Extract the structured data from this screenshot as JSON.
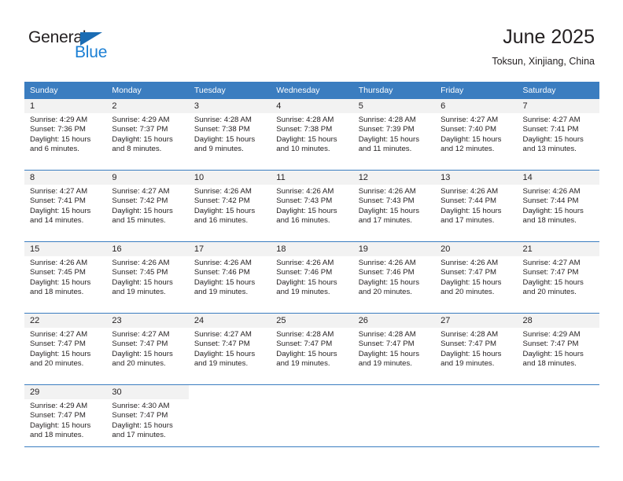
{
  "brand": {
    "name_part1": "General",
    "name_part2": "Blue",
    "accent_color": "#1b7fd4",
    "triangle_color": "#1b6cb3"
  },
  "header": {
    "title": "June 2025",
    "subtitle": "Toksun, Xinjiang, China"
  },
  "theme": {
    "header_band_color": "#3b7dc0",
    "daynum_band_color": "#f2f2f2",
    "text_color": "#231f20"
  },
  "calendar": {
    "weekday_headers": [
      "Sunday",
      "Monday",
      "Tuesday",
      "Wednesday",
      "Thursday",
      "Friday",
      "Saturday"
    ],
    "weeks": [
      [
        {
          "day": "1",
          "sunrise": "Sunrise: 4:29 AM",
          "sunset": "Sunset: 7:36 PM",
          "daylight": "Daylight: 15 hours and 6 minutes."
        },
        {
          "day": "2",
          "sunrise": "Sunrise: 4:29 AM",
          "sunset": "Sunset: 7:37 PM",
          "daylight": "Daylight: 15 hours and 8 minutes."
        },
        {
          "day": "3",
          "sunrise": "Sunrise: 4:28 AM",
          "sunset": "Sunset: 7:38 PM",
          "daylight": "Daylight: 15 hours and 9 minutes."
        },
        {
          "day": "4",
          "sunrise": "Sunrise: 4:28 AM",
          "sunset": "Sunset: 7:38 PM",
          "daylight": "Daylight: 15 hours and 10 minutes."
        },
        {
          "day": "5",
          "sunrise": "Sunrise: 4:28 AM",
          "sunset": "Sunset: 7:39 PM",
          "daylight": "Daylight: 15 hours and 11 minutes."
        },
        {
          "day": "6",
          "sunrise": "Sunrise: 4:27 AM",
          "sunset": "Sunset: 7:40 PM",
          "daylight": "Daylight: 15 hours and 12 minutes."
        },
        {
          "day": "7",
          "sunrise": "Sunrise: 4:27 AM",
          "sunset": "Sunset: 7:41 PM",
          "daylight": "Daylight: 15 hours and 13 minutes."
        }
      ],
      [
        {
          "day": "8",
          "sunrise": "Sunrise: 4:27 AM",
          "sunset": "Sunset: 7:41 PM",
          "daylight": "Daylight: 15 hours and 14 minutes."
        },
        {
          "day": "9",
          "sunrise": "Sunrise: 4:27 AM",
          "sunset": "Sunset: 7:42 PM",
          "daylight": "Daylight: 15 hours and 15 minutes."
        },
        {
          "day": "10",
          "sunrise": "Sunrise: 4:26 AM",
          "sunset": "Sunset: 7:42 PM",
          "daylight": "Daylight: 15 hours and 16 minutes."
        },
        {
          "day": "11",
          "sunrise": "Sunrise: 4:26 AM",
          "sunset": "Sunset: 7:43 PM",
          "daylight": "Daylight: 15 hours and 16 minutes."
        },
        {
          "day": "12",
          "sunrise": "Sunrise: 4:26 AM",
          "sunset": "Sunset: 7:43 PM",
          "daylight": "Daylight: 15 hours and 17 minutes."
        },
        {
          "day": "13",
          "sunrise": "Sunrise: 4:26 AM",
          "sunset": "Sunset: 7:44 PM",
          "daylight": "Daylight: 15 hours and 17 minutes."
        },
        {
          "day": "14",
          "sunrise": "Sunrise: 4:26 AM",
          "sunset": "Sunset: 7:44 PM",
          "daylight": "Daylight: 15 hours and 18 minutes."
        }
      ],
      [
        {
          "day": "15",
          "sunrise": "Sunrise: 4:26 AM",
          "sunset": "Sunset: 7:45 PM",
          "daylight": "Daylight: 15 hours and 18 minutes."
        },
        {
          "day": "16",
          "sunrise": "Sunrise: 4:26 AM",
          "sunset": "Sunset: 7:45 PM",
          "daylight": "Daylight: 15 hours and 19 minutes."
        },
        {
          "day": "17",
          "sunrise": "Sunrise: 4:26 AM",
          "sunset": "Sunset: 7:46 PM",
          "daylight": "Daylight: 15 hours and 19 minutes."
        },
        {
          "day": "18",
          "sunrise": "Sunrise: 4:26 AM",
          "sunset": "Sunset: 7:46 PM",
          "daylight": "Daylight: 15 hours and 19 minutes."
        },
        {
          "day": "19",
          "sunrise": "Sunrise: 4:26 AM",
          "sunset": "Sunset: 7:46 PM",
          "daylight": "Daylight: 15 hours and 20 minutes."
        },
        {
          "day": "20",
          "sunrise": "Sunrise: 4:26 AM",
          "sunset": "Sunset: 7:47 PM",
          "daylight": "Daylight: 15 hours and 20 minutes."
        },
        {
          "day": "21",
          "sunrise": "Sunrise: 4:27 AM",
          "sunset": "Sunset: 7:47 PM",
          "daylight": "Daylight: 15 hours and 20 minutes."
        }
      ],
      [
        {
          "day": "22",
          "sunrise": "Sunrise: 4:27 AM",
          "sunset": "Sunset: 7:47 PM",
          "daylight": "Daylight: 15 hours and 20 minutes."
        },
        {
          "day": "23",
          "sunrise": "Sunrise: 4:27 AM",
          "sunset": "Sunset: 7:47 PM",
          "daylight": "Daylight: 15 hours and 20 minutes."
        },
        {
          "day": "24",
          "sunrise": "Sunrise: 4:27 AM",
          "sunset": "Sunset: 7:47 PM",
          "daylight": "Daylight: 15 hours and 19 minutes."
        },
        {
          "day": "25",
          "sunrise": "Sunrise: 4:28 AM",
          "sunset": "Sunset: 7:47 PM",
          "daylight": "Daylight: 15 hours and 19 minutes."
        },
        {
          "day": "26",
          "sunrise": "Sunrise: 4:28 AM",
          "sunset": "Sunset: 7:47 PM",
          "daylight": "Daylight: 15 hours and 19 minutes."
        },
        {
          "day": "27",
          "sunrise": "Sunrise: 4:28 AM",
          "sunset": "Sunset: 7:47 PM",
          "daylight": "Daylight: 15 hours and 19 minutes."
        },
        {
          "day": "28",
          "sunrise": "Sunrise: 4:29 AM",
          "sunset": "Sunset: 7:47 PM",
          "daylight": "Daylight: 15 hours and 18 minutes."
        }
      ],
      [
        {
          "day": "29",
          "sunrise": "Sunrise: 4:29 AM",
          "sunset": "Sunset: 7:47 PM",
          "daylight": "Daylight: 15 hours and 18 minutes."
        },
        {
          "day": "30",
          "sunrise": "Sunrise: 4:30 AM",
          "sunset": "Sunset: 7:47 PM",
          "daylight": "Daylight: 15 hours and 17 minutes."
        },
        {
          "day": "",
          "sunrise": "",
          "sunset": "",
          "daylight": ""
        },
        {
          "day": "",
          "sunrise": "",
          "sunset": "",
          "daylight": ""
        },
        {
          "day": "",
          "sunrise": "",
          "sunset": "",
          "daylight": ""
        },
        {
          "day": "",
          "sunrise": "",
          "sunset": "",
          "daylight": ""
        },
        {
          "day": "",
          "sunrise": "",
          "sunset": "",
          "daylight": ""
        }
      ]
    ]
  }
}
